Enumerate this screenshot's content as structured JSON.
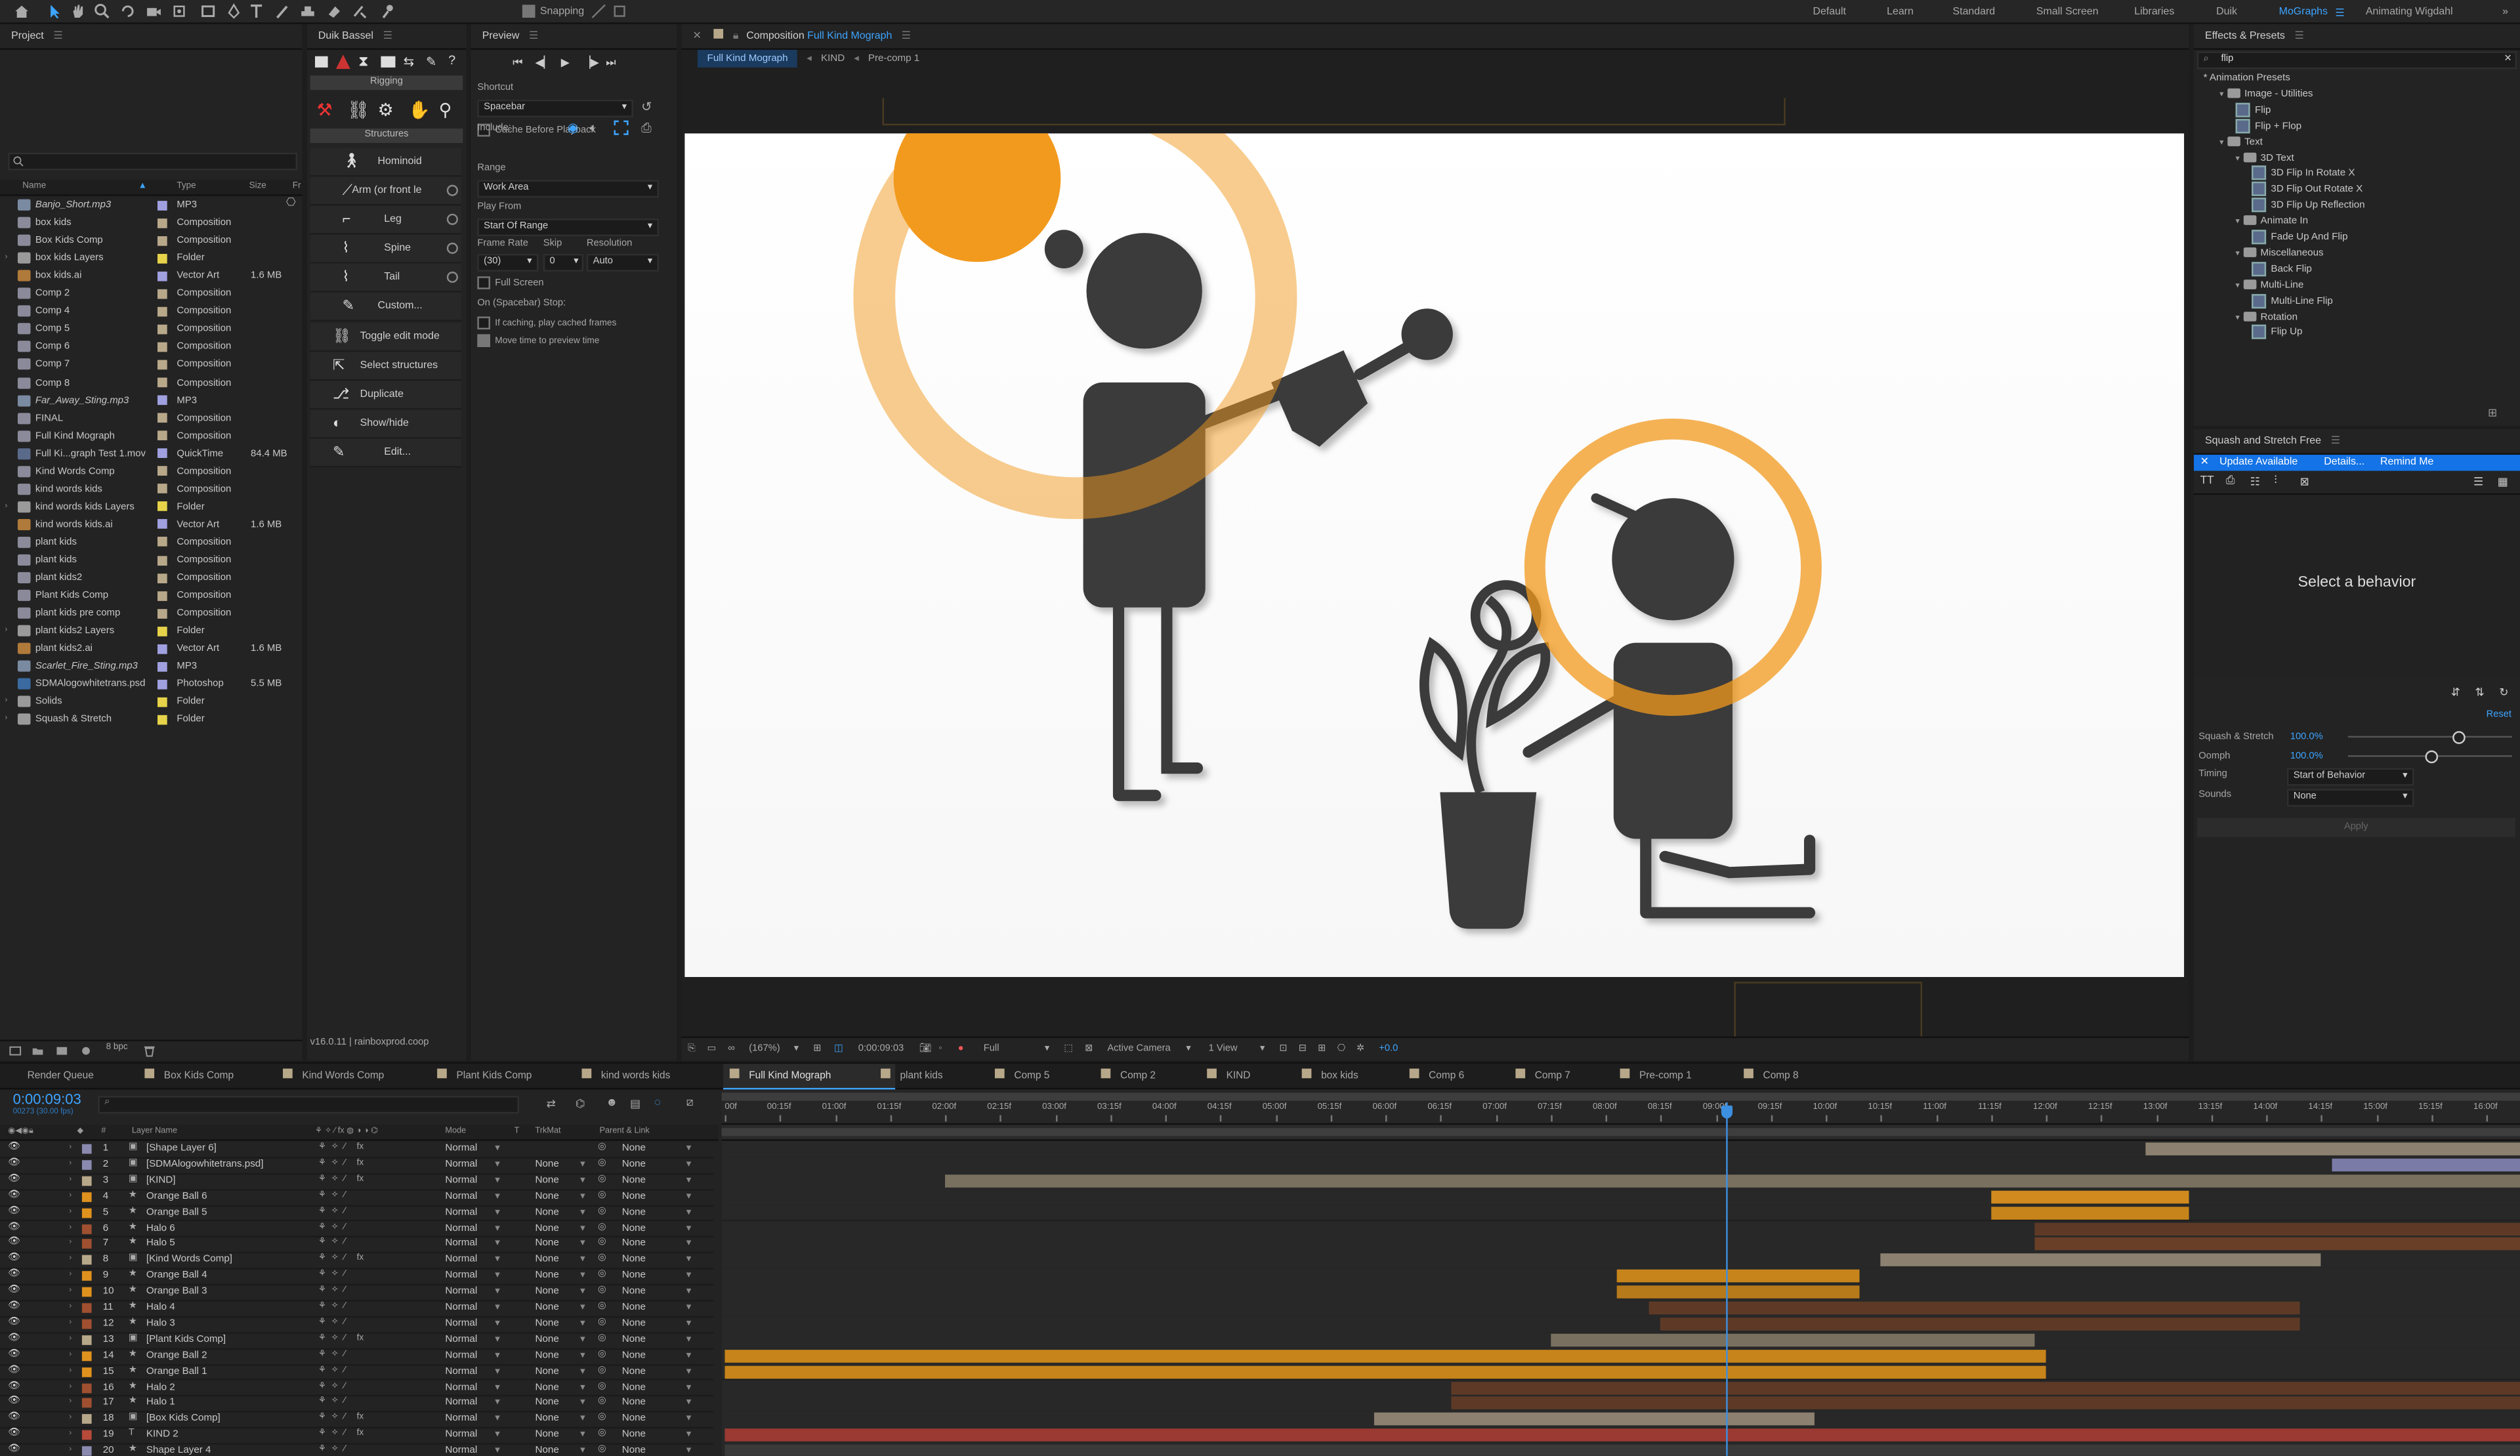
{
  "toolbar": {
    "snapping": "Snapping",
    "workspaces": [
      "Default",
      "Learn",
      "Standard",
      "Small Screen",
      "Libraries",
      "Duik",
      "MoGraphs",
      "Animating Wigdahl"
    ],
    "active_workspace": "MoGraphs"
  },
  "project": {
    "title": "Project",
    "columns": {
      "name": "Name",
      "type": "Type",
      "size": "Size",
      "fr": "Fr"
    },
    "bpc": "8 bpc",
    "items": [
      {
        "name": "Banjo_Short.mp3",
        "type": "MP3",
        "size": "",
        "kind": "audio",
        "color": "#a0a0e0"
      },
      {
        "name": "box kids",
        "type": "Composition",
        "size": "",
        "kind": "comp",
        "color": "#b8a88a"
      },
      {
        "name": "Box Kids Comp",
        "type": "Composition",
        "size": "",
        "kind": "comp",
        "color": "#b8a88a"
      },
      {
        "name": "box kids Layers",
        "type": "Folder",
        "size": "",
        "kind": "folder",
        "color": "#e6d34a"
      },
      {
        "name": "box kids.ai",
        "type": "Vector Art",
        "size": "1.6 MB",
        "kind": "ai",
        "color": "#a0a0e0"
      },
      {
        "name": "Comp 2",
        "type": "Composition",
        "size": "",
        "kind": "comp",
        "color": "#b8a88a"
      },
      {
        "name": "Comp 4",
        "type": "Composition",
        "size": "",
        "kind": "comp",
        "color": "#b8a88a"
      },
      {
        "name": "Comp 5",
        "type": "Composition",
        "size": "",
        "kind": "comp",
        "color": "#b8a88a"
      },
      {
        "name": "Comp 6",
        "type": "Composition",
        "size": "",
        "kind": "comp",
        "color": "#b8a88a"
      },
      {
        "name": "Comp 7",
        "type": "Composition",
        "size": "",
        "kind": "comp",
        "color": "#b8a88a"
      },
      {
        "name": "Comp 8",
        "type": "Composition",
        "size": "",
        "kind": "comp",
        "color": "#b8a88a"
      },
      {
        "name": "Far_Away_Sting.mp3",
        "type": "MP3",
        "size": "",
        "kind": "audio",
        "color": "#a0a0e0"
      },
      {
        "name": "FINAL",
        "type": "Composition",
        "size": "",
        "kind": "comp",
        "color": "#b8a88a"
      },
      {
        "name": "Full Kind Mograph",
        "type": "Composition",
        "size": "",
        "kind": "comp",
        "color": "#b8a88a"
      },
      {
        "name": "Full Ki...graph Test 1.mov",
        "type": "QuickTime",
        "size": "84.4 MB",
        "kind": "mov",
        "color": "#a0a0e0"
      },
      {
        "name": "Kind Words Comp",
        "type": "Composition",
        "size": "",
        "kind": "comp",
        "color": "#b8a88a"
      },
      {
        "name": "kind words kids",
        "type": "Composition",
        "size": "",
        "kind": "comp",
        "color": "#b8a88a"
      },
      {
        "name": "kind words kids Layers",
        "type": "Folder",
        "size": "",
        "kind": "folder",
        "color": "#e6d34a"
      },
      {
        "name": "kind words kids.ai",
        "type": "Vector Art",
        "size": "1.6 MB",
        "kind": "ai",
        "color": "#a0a0e0"
      },
      {
        "name": "plant kids",
        "type": "Composition",
        "size": "",
        "kind": "comp",
        "color": "#b8a88a"
      },
      {
        "name": "plant kids",
        "type": "Composition",
        "size": "",
        "kind": "comp",
        "color": "#b8a88a"
      },
      {
        "name": "plant kids2",
        "type": "Composition",
        "size": "",
        "kind": "comp",
        "color": "#b8a88a"
      },
      {
        "name": "Plant Kids Comp",
        "type": "Composition",
        "size": "",
        "kind": "comp",
        "color": "#b8a88a"
      },
      {
        "name": "plant kids pre comp",
        "type": "Composition",
        "size": "",
        "kind": "comp",
        "color": "#b8a88a"
      },
      {
        "name": "plant kids2 Layers",
        "type": "Folder",
        "size": "",
        "kind": "folder",
        "color": "#e6d34a"
      },
      {
        "name": "plant kids2.ai",
        "type": "Vector Art",
        "size": "1.6 MB",
        "kind": "ai",
        "color": "#a0a0e0"
      },
      {
        "name": "Scarlet_Fire_Sting.mp3",
        "type": "MP3",
        "size": "",
        "kind": "audio",
        "color": "#a0a0e0"
      },
      {
        "name": "SDMAlogowhitetrans.psd",
        "type": "Photoshop",
        "size": "5.5 MB",
        "kind": "psd",
        "color": "#a0a0e0"
      },
      {
        "name": "Solids",
        "type": "Folder",
        "size": "",
        "kind": "folder",
        "color": "#e6d34a"
      },
      {
        "name": "Squash & Stretch",
        "type": "Folder",
        "size": "",
        "kind": "folder",
        "color": "#e6d34a"
      }
    ]
  },
  "duik": {
    "title": "Duik Bassel",
    "rigging": "Rigging",
    "structures": "Structures",
    "buttons": [
      "Hominoid",
      "Arm (or front le",
      "Leg",
      "Spine",
      "Tail",
      "Custom..."
    ],
    "tools": [
      "Toggle edit mode",
      "Select structures",
      "Duplicate",
      "Show/hide",
      "Edit..."
    ],
    "version": "v16.0.11 | rainboxprod.coop"
  },
  "preview": {
    "title": "Preview",
    "shortcut_label": "Shortcut",
    "shortcut": "Spacebar",
    "include": "Include:",
    "cache_before": "Cache Before Playback",
    "range_label": "Range",
    "range": "Work Area",
    "play_from_label": "Play From",
    "play_from": "Start Of Range",
    "frame_rate_label": "Frame Rate",
    "skip_label": "Skip",
    "resolution_label": "Resolution",
    "frame_rate": "(30)",
    "skip": "0",
    "resolution": "Auto",
    "full_screen": "Full Screen",
    "stop_label": "On (Spacebar) Stop:",
    "if_caching": "If caching, play cached frames",
    "move_time": "Move time to preview time"
  },
  "comp": {
    "tab_prefix": "Composition",
    "tab_name": "Full Kind Mograph",
    "breadcrumbs": [
      "Full Kind Mograph",
      "KIND",
      "Pre-comp 1"
    ],
    "zoom": "(167%)",
    "timecode": "0:00:09:03",
    "quality": "Full",
    "camera": "Active Camera",
    "views": "1 View",
    "exposure": "+0.0"
  },
  "effects": {
    "title": "Effects & Presets",
    "search": "flip",
    "tree": [
      {
        "label": "* Animation Presets",
        "level": 0,
        "kind": "root"
      },
      {
        "label": "Image - Utilities",
        "level": 1,
        "kind": "folder"
      },
      {
        "label": "Flip",
        "level": 2,
        "kind": "preset"
      },
      {
        "label": "Flip + Flop",
        "level": 2,
        "kind": "preset"
      },
      {
        "label": "Text",
        "level": 1,
        "kind": "folder"
      },
      {
        "label": "3D Text",
        "level": 2,
        "kind": "folder"
      },
      {
        "label": "3D Flip In Rotate X",
        "level": 3,
        "kind": "preset"
      },
      {
        "label": "3D Flip Out Rotate X",
        "level": 3,
        "kind": "preset"
      },
      {
        "label": "3D Flip Up Reflection",
        "level": 3,
        "kind": "preset"
      },
      {
        "label": "Animate In",
        "level": 2,
        "kind": "folder"
      },
      {
        "label": "Fade Up And Flip",
        "level": 3,
        "kind": "preset"
      },
      {
        "label": "Miscellaneous",
        "level": 2,
        "kind": "folder"
      },
      {
        "label": "Back Flip",
        "level": 3,
        "kind": "preset"
      },
      {
        "label": "Multi-Line",
        "level": 2,
        "kind": "folder"
      },
      {
        "label": "Multi-Line Flip",
        "level": 3,
        "kind": "preset"
      },
      {
        "label": "Rotation",
        "level": 2,
        "kind": "folder"
      },
      {
        "label": "Flip Up",
        "level": 3,
        "kind": "preset"
      }
    ]
  },
  "squash": {
    "title": "Squash and Stretch Free",
    "update": "Update Available",
    "details": "Details...",
    "remind": "Remind Me",
    "select": "Select a behavior",
    "reset": "Reset",
    "ss_label": "Squash & Stretch",
    "ss_value": "100.0%",
    "oomph_label": "Oomph",
    "oomph_value": "100.0%",
    "timing_label": "Timing",
    "timing": "Start of Behavior",
    "sounds_label": "Sounds",
    "sounds": "None",
    "apply": "Apply"
  },
  "timeline": {
    "tabs": [
      {
        "label": "Render Queue",
        "color": ""
      },
      {
        "label": "Box Kids Comp",
        "color": "#b8a88a"
      },
      {
        "label": "Kind Words Comp",
        "color": "#b8a88a"
      },
      {
        "label": "Plant Kids Comp",
        "color": "#b8a88a"
      },
      {
        "label": "kind words kids",
        "color": "#b8a88a"
      },
      {
        "label": "Full Kind Mograph",
        "color": "#b8a88a",
        "active": true
      },
      {
        "label": "plant kids",
        "color": "#b8a88a"
      },
      {
        "label": "Comp 5",
        "color": "#b8a88a"
      },
      {
        "label": "Comp 2",
        "color": "#b8a88a"
      },
      {
        "label": "KIND",
        "color": "#b8a88a"
      },
      {
        "label": "box kids",
        "color": "#b8a88a"
      },
      {
        "label": "Comp 6",
        "color": "#b8a88a"
      },
      {
        "label": "Comp 7",
        "color": "#b8a88a"
      },
      {
        "label": "Pre-comp 1",
        "color": "#b8a88a"
      },
      {
        "label": "Comp 8",
        "color": "#b8a88a"
      }
    ],
    "timecode": "0:00:09:03",
    "fps": "00273 (30.00 fps)",
    "headers": {
      "num": "#",
      "layer_name": "Layer Name",
      "mode": "Mode",
      "t": "T",
      "trkmat": "TrkMat",
      "parent": "Parent & Link"
    },
    "ruler": [
      "00f",
      "00:15f",
      "01:00f",
      "01:15f",
      "02:00f",
      "02:15f",
      "03:00f",
      "03:15f",
      "04:00f",
      "04:15f",
      "05:00f",
      "05:15f",
      "06:00f",
      "06:15f",
      "07:00f",
      "07:15f",
      "08:00f",
      "08:15f",
      "09:00f",
      "09:15f",
      "10:00f",
      "10:15f",
      "11:00f",
      "11:15f",
      "12:00f",
      "12:15f",
      "13:00f",
      "13:15f",
      "14:00f",
      "14:15f",
      "15:00f",
      "15:15f",
      "16:00f"
    ],
    "playhead_seconds": 9.1,
    "ruler_max_seconds": 16.0,
    "layers": [
      {
        "num": "1",
        "name": "[Shape Layer 6]",
        "label": "#8a8ab0",
        "mode": "Normal",
        "trkmat": "",
        "parent": "None",
        "bar_color": "#8c8070",
        "start": 12.9,
        "end": 16.3
      },
      {
        "num": "2",
        "name": "[SDMAlogowhitetrans.psd]",
        "label": "#8a8ab0",
        "mode": "Normal",
        "trkmat": "None",
        "parent": "None",
        "bar_color": "#7b7ba8",
        "start": 14.6,
        "end": 16.3
      },
      {
        "num": "3",
        "name": "[KIND]",
        "label": "#b8a88a",
        "mode": "Normal",
        "trkmat": "None",
        "parent": "None",
        "bar_color": "#7a7060",
        "start": 2.0,
        "end": 16.3
      },
      {
        "num": "4",
        "name": "Orange Ball 6",
        "label": "#e0921e",
        "mode": "Normal",
        "trkmat": "None",
        "parent": "None",
        "bar_color": "#d08a1e",
        "start": 11.5,
        "end": 13.3
      },
      {
        "num": "5",
        "name": "Orange Ball 5",
        "label": "#e0921e",
        "mode": "Normal",
        "trkmat": "None",
        "parent": "None",
        "bar_color": "#c7841a",
        "start": 11.5,
        "end": 13.3
      },
      {
        "num": "6",
        "name": "Halo 6",
        "label": "#a05030",
        "mode": "Normal",
        "trkmat": "None",
        "parent": "None",
        "bar_color": "#5e3a26",
        "start": 11.9,
        "end": 16.3
      },
      {
        "num": "7",
        "name": "Halo 5",
        "label": "#a05030",
        "mode": "Normal",
        "trkmat": "None",
        "parent": "None",
        "bar_color": "#6a3f28",
        "start": 11.9,
        "end": 16.3
      },
      {
        "num": "8",
        "name": "[Kind Words Comp]",
        "label": "#b8a88a",
        "mode": "Normal",
        "trkmat": "None",
        "parent": "None",
        "bar_color": "#8c8070",
        "start": 10.5,
        "end": 14.5
      },
      {
        "num": "9",
        "name": "Orange Ball 4",
        "label": "#e0921e",
        "mode": "Normal",
        "trkmat": "None",
        "parent": "None",
        "bar_color": "#c7841a",
        "start": 8.1,
        "end": 10.3
      },
      {
        "num": "10",
        "name": "Orange Ball 3",
        "label": "#e0921e",
        "mode": "Normal",
        "trkmat": "None",
        "parent": "None",
        "bar_color": "#b77a1a",
        "start": 8.1,
        "end": 10.3
      },
      {
        "num": "11",
        "name": "Halo 4",
        "label": "#a05030",
        "mode": "Normal",
        "trkmat": "None",
        "parent": "None",
        "bar_color": "#5e3a26",
        "start": 8.4,
        "end": 14.3
      },
      {
        "num": "12",
        "name": "Halo 3",
        "label": "#a05030",
        "mode": "Normal",
        "trkmat": "None",
        "parent": "None",
        "bar_color": "#5e3a26",
        "start": 8.5,
        "end": 14.3
      },
      {
        "num": "13",
        "name": "[Plant Kids Comp]",
        "label": "#b8a88a",
        "mode": "Normal",
        "trkmat": "None",
        "parent": "None",
        "bar_color": "#7a7060",
        "start": 7.5,
        "end": 11.9
      },
      {
        "num": "14",
        "name": "Orange Ball 2",
        "label": "#e0921e",
        "mode": "Normal",
        "trkmat": "None",
        "parent": "None",
        "bar_color": "#c7841a",
        "start": 0.0,
        "end": 12.0
      },
      {
        "num": "15",
        "name": "Orange Ball 1",
        "label": "#e0921e",
        "mode": "Normal",
        "trkmat": "None",
        "parent": "None",
        "bar_color": "#c7841a",
        "start": 0.0,
        "end": 12.0
      },
      {
        "num": "16",
        "name": "Halo 2",
        "label": "#a05030",
        "mode": "Normal",
        "trkmat": "None",
        "parent": "None",
        "bar_color": "#5e3a26",
        "start": 6.6,
        "end": 16.3
      },
      {
        "num": "17",
        "name": "Halo 1",
        "label": "#a05030",
        "mode": "Normal",
        "trkmat": "None",
        "parent": "None",
        "bar_color": "#5e3a26",
        "start": 6.6,
        "end": 16.3
      },
      {
        "num": "18",
        "name": "[Box Kids Comp]",
        "label": "#b8a88a",
        "mode": "Normal",
        "trkmat": "None",
        "parent": "None",
        "bar_color": "#8c8070",
        "start": 5.9,
        "end": 9.9
      },
      {
        "num": "19",
        "name": "KIND 2",
        "label": "#b84a3a",
        "mode": "Normal",
        "trkmat": "None",
        "parent": "None",
        "bar_color": "#9a3a32",
        "start": 0.0,
        "end": 16.3
      },
      {
        "num": "20",
        "name": "Shape Layer 4",
        "label": "#8a8ab0",
        "mode": "Normal",
        "trkmat": "None",
        "parent": "None",
        "bar_color": "#3a3a3a",
        "start": 0.0,
        "end": 16.3
      }
    ]
  }
}
